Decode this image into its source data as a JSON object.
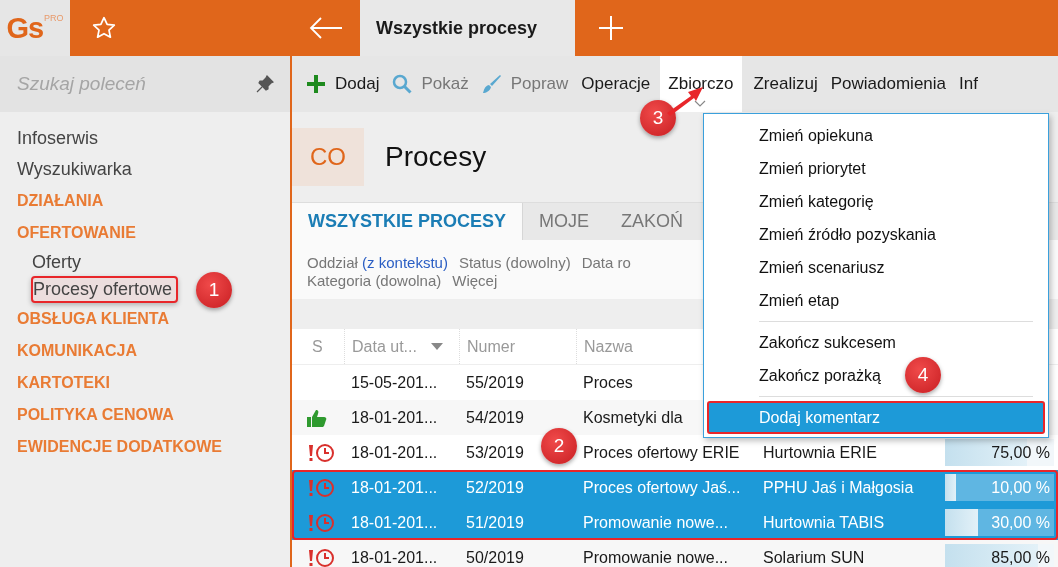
{
  "logo": {
    "text": "Gs",
    "badge": "PRO"
  },
  "top_tab": {
    "label": "Wszystkie procesy"
  },
  "sidebar": {
    "search": {
      "placeholder": "Szukaj poleceń"
    },
    "items": [
      {
        "kind": "link",
        "label": "Infoserwis",
        "outlined": false
      },
      {
        "kind": "link",
        "label": "Wyszukiwarka",
        "outlined": false
      },
      {
        "kind": "section",
        "label": "DZIAŁANIA",
        "outlined": false
      },
      {
        "kind": "section",
        "label": "OFERTOWANIE",
        "outlined": false
      },
      {
        "kind": "sub",
        "label": "Oferty",
        "outlined": false
      },
      {
        "kind": "sub",
        "label": "Procesy ofertowe",
        "outlined": true
      },
      {
        "kind": "section",
        "label": "OBSŁUGA KLIENTA",
        "outlined": false
      },
      {
        "kind": "section",
        "label": "KOMUNIKACJA",
        "outlined": false
      },
      {
        "kind": "section",
        "label": "KARTOTEKI",
        "outlined": false
      },
      {
        "kind": "section",
        "label": "POLITYKA CENOWA",
        "outlined": false
      },
      {
        "kind": "section",
        "label": "EWIDENCJE DODATKOWE",
        "outlined": false
      }
    ]
  },
  "toolbar": [
    {
      "kind": "add",
      "label": "Dodaj",
      "disabled": false,
      "open": false
    },
    {
      "kind": "view",
      "label": "Pokaż",
      "disabled": true,
      "open": false
    },
    {
      "kind": "edit",
      "label": "Popraw",
      "disabled": true,
      "open": false
    },
    {
      "kind": "text",
      "label": "Operacje",
      "disabled": false,
      "open": false
    },
    {
      "kind": "text",
      "label": "Zbiorczo",
      "disabled": false,
      "open": true
    },
    {
      "kind": "text",
      "label": "Zrealizuj",
      "disabled": false,
      "open": false
    },
    {
      "kind": "text",
      "label": "Powiadomienia",
      "disabled": false,
      "open": false
    },
    {
      "kind": "text",
      "label": "Inf",
      "disabled": false,
      "open": false
    }
  ],
  "header": {
    "code": "CO",
    "title": "Procesy"
  },
  "tabs": [
    {
      "label": "WSZYSTKIE PROCESY",
      "selected": true
    },
    {
      "label": "MOJE",
      "selected": false
    },
    {
      "label": "ZAKOŃ",
      "selected": false
    }
  ],
  "filters": [
    [
      {
        "text": "Oddział",
        "link": "(z kontekstu)"
      },
      {
        "text": "Status (dowolny)"
      },
      {
        "text": "Data ro"
      }
    ],
    [
      {
        "text": "Kategoria (dowolna)"
      },
      {
        "text": "Więcej"
      }
    ]
  ],
  "table": {
    "columns": [
      {
        "label": "S"
      },
      {
        "label": "Data ut...",
        "sorted": true
      },
      {
        "label": "Numer"
      },
      {
        "label": "Nazwa"
      }
    ],
    "selection_outlined": true,
    "rows": [
      {
        "kind": "plain",
        "date": "15-05-201...",
        "number": "55/2019",
        "name": "Proces",
        "selected": false
      },
      {
        "kind": "won",
        "date": "18-01-201...",
        "number": "54/2019",
        "name": "Kosmetyki dla",
        "selected": false
      },
      {
        "kind": "overdue",
        "date": "18-01-201...",
        "number": "53/2019",
        "name": "Proces ofertowy ERIE",
        "client": "Hurtownia ERIE",
        "level": 0.75,
        "progress": "75,00 %",
        "selected": false
      },
      {
        "kind": "overdue",
        "date": "18-01-201...",
        "number": "52/2019",
        "name": "Proces ofertowy Jaś...",
        "client": "PPHU Jaś i Małgosia",
        "level": 0.1,
        "progress": "10,00 %",
        "selected": true
      },
      {
        "kind": "overdue",
        "date": "18-01-201...",
        "number": "51/2019",
        "name": "Promowanie nowe...",
        "client": "Hurtownia TABIS",
        "level": 0.3,
        "progress": "30,00 %",
        "selected": true
      },
      {
        "kind": "overdue",
        "date": "18-01-201...",
        "number": "50/2019",
        "name": "Promowanie nowe...",
        "client": "Solarium SUN",
        "level": 0.85,
        "progress": "85,00 %",
        "selected": false
      }
    ]
  },
  "menu": {
    "groups": [
      [
        {
          "label": "Zmień opiekuna",
          "selected": false,
          "outlined": false
        },
        {
          "label": "Zmień priorytet",
          "selected": false,
          "outlined": false
        },
        {
          "label": "Zmień kategorię",
          "selected": false,
          "outlined": false
        },
        {
          "label": "Zmień źródło pozyskania",
          "selected": false,
          "outlined": false
        },
        {
          "label": "Zmień scenariusz",
          "selected": false,
          "outlined": false
        },
        {
          "label": "Zmień etap",
          "selected": false,
          "outlined": false
        }
      ],
      [
        {
          "label": "Zakończ sukcesem",
          "selected": false,
          "outlined": false
        },
        {
          "label": "Zakończ porażką",
          "selected": false,
          "outlined": false
        }
      ],
      [
        {
          "label": "Dodaj komentarz",
          "selected": true,
          "outlined": true
        }
      ]
    ]
  },
  "annotations": [
    {
      "number": "1"
    },
    {
      "number": "2"
    },
    {
      "number": "3",
      "arrow": true
    },
    {
      "number": "4"
    }
  ]
}
